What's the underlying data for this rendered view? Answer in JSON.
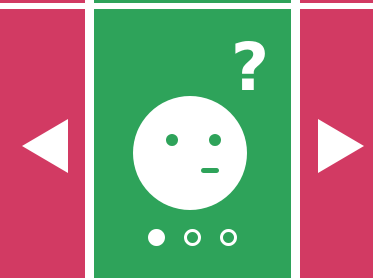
{
  "colors": {
    "accent_side": "#d23a63",
    "card_bg": "#2ea35a",
    "icon_fg": "#ffffff"
  },
  "carousel": {
    "prev_button": {
      "icon": "triangle-left-icon"
    },
    "next_button": {
      "icon": "triangle-right-icon"
    },
    "card": {
      "icon_face": "confused-face-icon",
      "icon_question": "question-mark-icon",
      "question_mark": "?"
    },
    "pagination": {
      "count": 3,
      "active_index": 0
    }
  }
}
